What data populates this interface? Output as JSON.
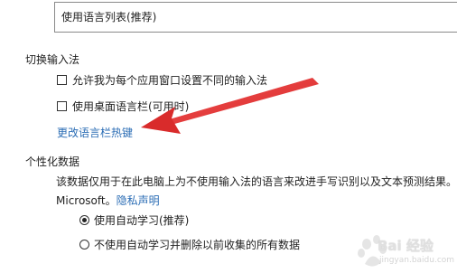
{
  "language_list_select": {
    "value": "使用语言列表(推荐)"
  },
  "switch_input_method": {
    "title": "切换输入法",
    "allow_per_app_checkbox": {
      "label": "允许我为每个应用窗口设置不同的输入法",
      "checked": false
    },
    "desktop_language_bar_checkbox": {
      "label": "使用桌面语言栏(可用时)",
      "checked": false
    },
    "change_hotkeys_link": "更改语言栏热键"
  },
  "personalization": {
    "title": "个性化数据",
    "description_line1": "该数据仅用于在此电脑上为不使用输入法的语言来改进手写识别以及文本预测结果。不",
    "description_line2_prefix": "Microsoft。",
    "privacy_link": "隐私声明",
    "options": [
      {
        "label": "使用自动学习(推荐)",
        "selected": true
      },
      {
        "label": "不使用自动学习并删除以前收集的所有数据",
        "selected": false
      }
    ]
  },
  "annotation": {
    "arrow_color": "#e23a3a"
  },
  "watermark": {
    "text": "Bai 经验",
    "sub": "jingyan.baidu.com"
  },
  "colors": {
    "link": "#2b6db5",
    "text": "#1f1f1f",
    "border": "#8a8a8a"
  }
}
